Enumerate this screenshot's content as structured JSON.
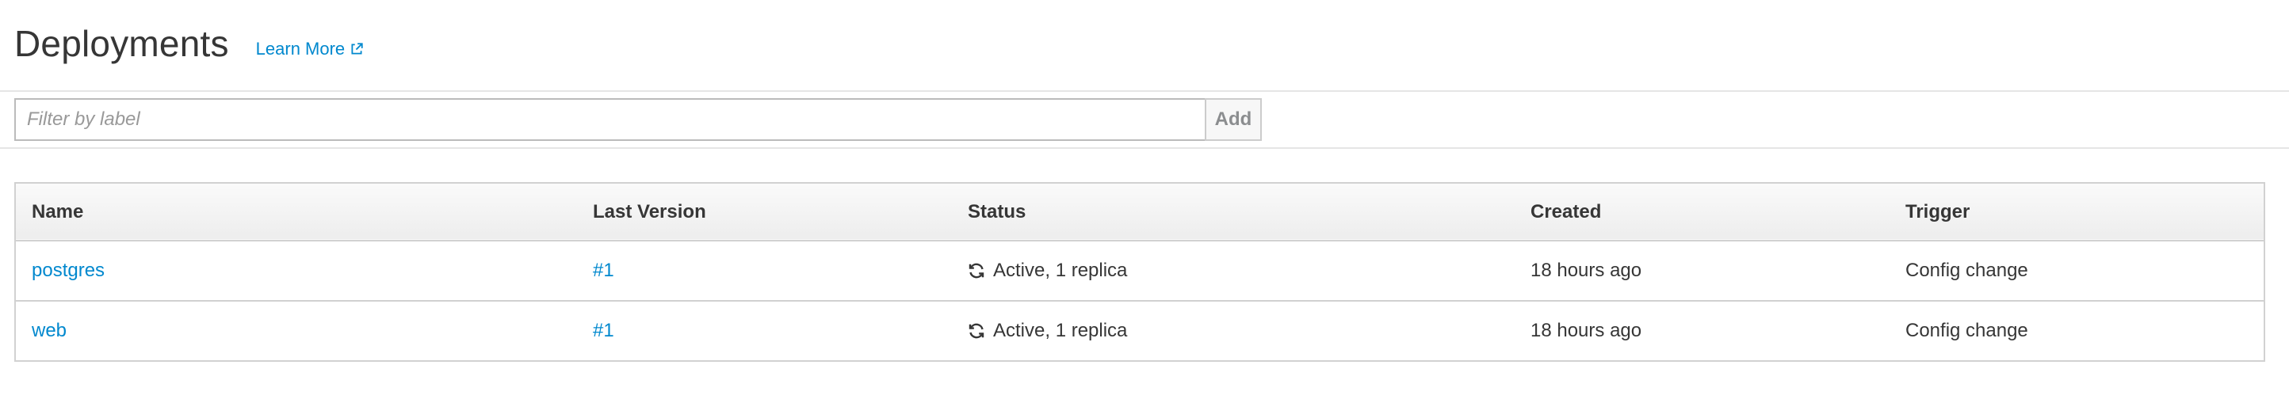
{
  "header": {
    "title": "Deployments",
    "learn_more_label": "Learn More",
    "external_link_icon": "external-link-icon"
  },
  "filter": {
    "placeholder": "Filter by label",
    "value": "",
    "add_label": "Add"
  },
  "table": {
    "columns": [
      "Name",
      "Last Version",
      "Status",
      "Created",
      "Trigger"
    ],
    "rows": [
      {
        "name": "postgres",
        "last_version": "#1",
        "status_icon": "sync-icon",
        "status": "Active, 1 replica",
        "created": "18 hours ago",
        "trigger": "Config change"
      },
      {
        "name": "web",
        "last_version": "#1",
        "status_icon": "sync-icon",
        "status": "Active, 1 replica",
        "created": "18 hours ago",
        "trigger": "Config change"
      }
    ]
  },
  "colors": {
    "link": "#0088ce",
    "text": "#363636",
    "border": "#d1d1d1",
    "header_bg": "#ededed"
  }
}
